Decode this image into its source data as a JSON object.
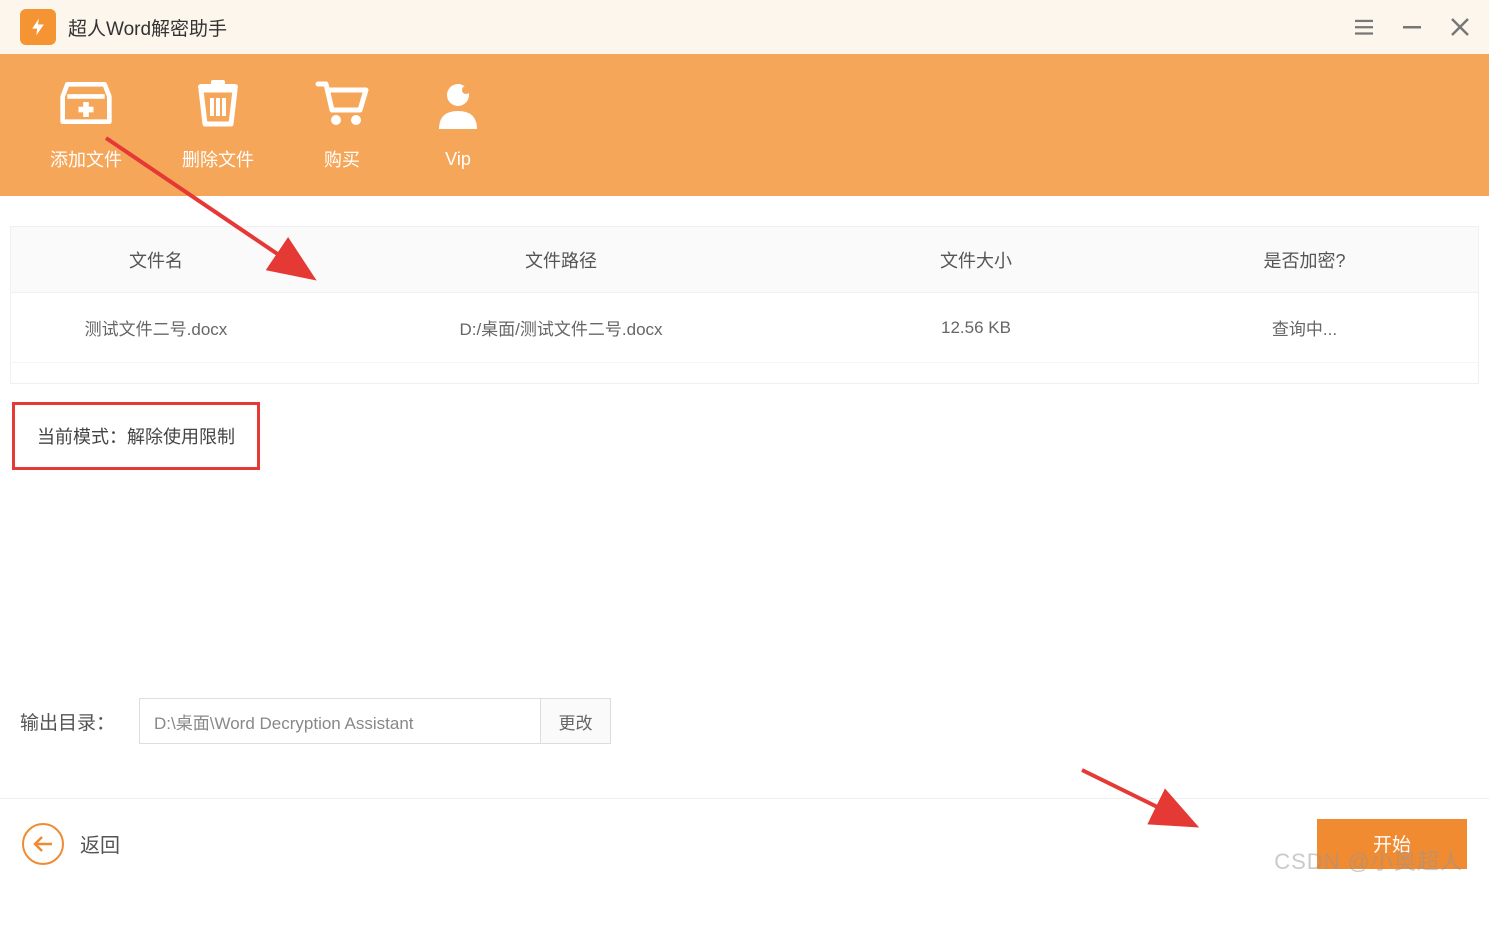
{
  "titlebar": {
    "app_title": "超人Word解密助手"
  },
  "toolbar": {
    "items": [
      {
        "label": "添加文件"
      },
      {
        "label": "删除文件"
      },
      {
        "label": "购买"
      },
      {
        "label": "Vip"
      }
    ]
  },
  "table": {
    "headers": {
      "filename": "文件名",
      "filepath": "文件路径",
      "filesize": "文件大小",
      "encrypted": "是否加密?"
    },
    "rows": [
      {
        "filename": "测试文件二号.docx",
        "filepath": "D:/桌面/测试文件二号.docx",
        "filesize": "12.56 KB",
        "encrypted": "查询中..."
      }
    ]
  },
  "mode": {
    "text": "当前模式：解除使用限制"
  },
  "output": {
    "label": "输出目录：",
    "path": "D:\\桌面\\Word Decryption Assistant",
    "change_btn": "更改"
  },
  "bottom": {
    "back": "返回",
    "start": "开始"
  },
  "watermark": "CSDN @小奥超人",
  "colors": {
    "accent": "#f6a659",
    "primary": "#f08b32",
    "annotation": "#e53935"
  }
}
